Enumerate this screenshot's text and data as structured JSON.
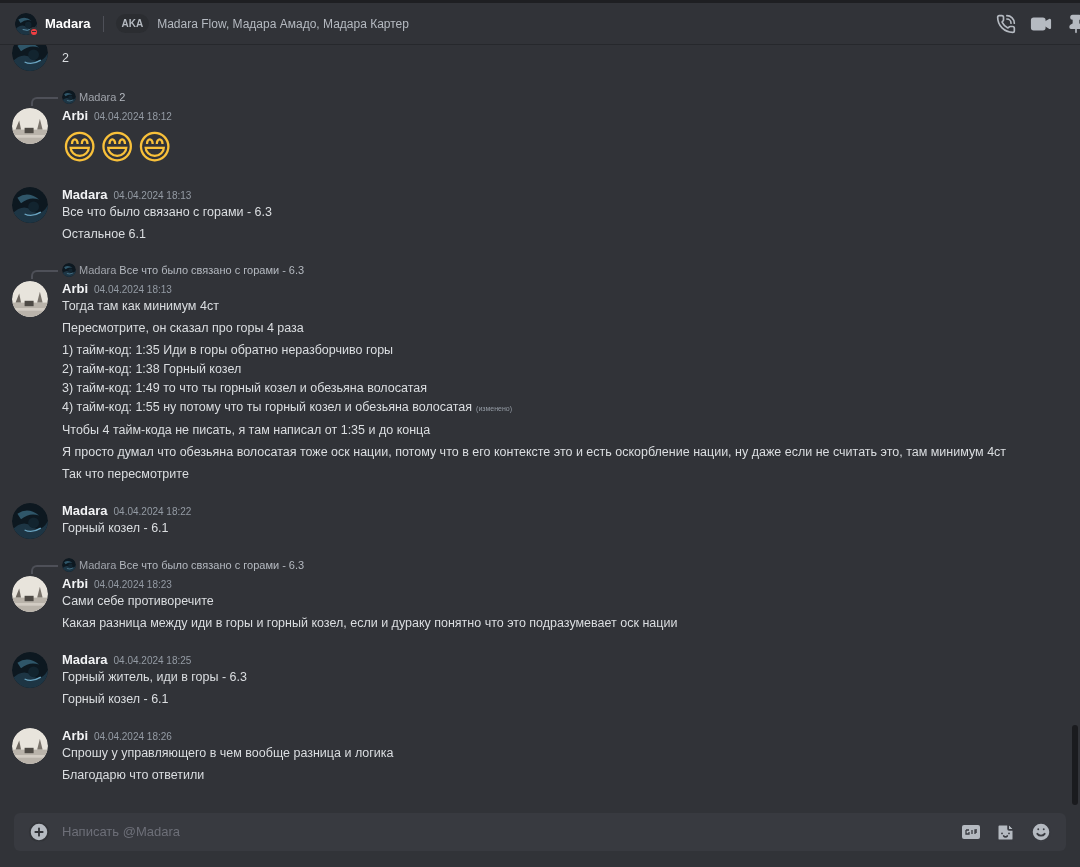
{
  "header": {
    "name": "Madara",
    "aka_label": "AKA",
    "aka_names": "Madara Flow, Мадара Амадо, Мадара Картер"
  },
  "groups": [
    {
      "messages": [
        {
          "lines": [
            "2"
          ]
        }
      ]
    },
    {
      "reply": {
        "author": "Madara",
        "text": "2"
      },
      "author": "Arbi",
      "time": "04.04.2024 18:12",
      "messages": [
        {
          "kind": "emoji",
          "lines": [
            "😄😄😄"
          ]
        }
      ]
    },
    {
      "author": "Madara",
      "time": "04.04.2024 18:13",
      "messages": [
        {
          "lines": [
            "Все что было связано с горами - 6.3"
          ]
        },
        {
          "lines": [
            "Остальное 6.1"
          ]
        }
      ]
    },
    {
      "reply": {
        "author": "Madara",
        "text": "Все что было связано с горами - 6.3"
      },
      "author": "Arbi",
      "time": "04.04.2024 18:13",
      "messages": [
        {
          "lines": [
            "Тогда там как минимум 4ст"
          ]
        },
        {
          "lines": [
            "Пересмотрите, он сказал про горы 4 раза"
          ]
        },
        {
          "lines": [
            "1) тайм-код: 1:35 Иди в горы обратно неразборчиво горы",
            "2) тайм-код: 1:38 Горный козел",
            "3) тайм-код: 1:49 то что ты горный козел и обезьяна волосатая",
            "4) тайм-код: 1:55 ну потому что ты горный козел и обезьяна волосатая"
          ],
          "edited": "(изменено)"
        },
        {
          "lines": [
            "Чтобы 4 тайм-кода не писать, я там написал от 1:35 и до конца"
          ]
        },
        {
          "lines": [
            "Я просто думал что обезьяна волосатая тоже оск нации, потому что в его контексте это и есть оскорбление нации, ну даже если не считать это, там минимум 4ст"
          ]
        },
        {
          "lines": [
            "Так что пересмотрите"
          ]
        }
      ]
    },
    {
      "author": "Madara",
      "time": "04.04.2024 18:22",
      "messages": [
        {
          "lines": [
            "Горный козел - 6.1"
          ]
        }
      ]
    },
    {
      "reply": {
        "author": "Madara",
        "text": "Все что было связано с горами - 6.3"
      },
      "author": "Arbi",
      "time": "04.04.2024 18:23",
      "messages": [
        {
          "lines": [
            "Сами себе противоречите"
          ]
        },
        {
          "lines": [
            "Какая разница между иди в горы и горный козел, если и дураку понятно что это подразумевает оск нации"
          ]
        }
      ]
    },
    {
      "author": "Madara",
      "time": "04.04.2024 18:25",
      "messages": [
        {
          "lines": [
            "Горный житель, иди в горы - 6.3"
          ]
        },
        {
          "lines": [
            "Горный козел - 6.1"
          ]
        }
      ]
    },
    {
      "author": "Arbi",
      "time": "04.04.2024 18:26",
      "messages": [
        {
          "lines": [
            "Спрошу у управляющего в чем вообще разница и логика"
          ]
        },
        {
          "lines": [
            "Благодарю что ответили"
          ]
        }
      ]
    }
  ],
  "composer": {
    "placeholder": "Написать @Madara"
  }
}
